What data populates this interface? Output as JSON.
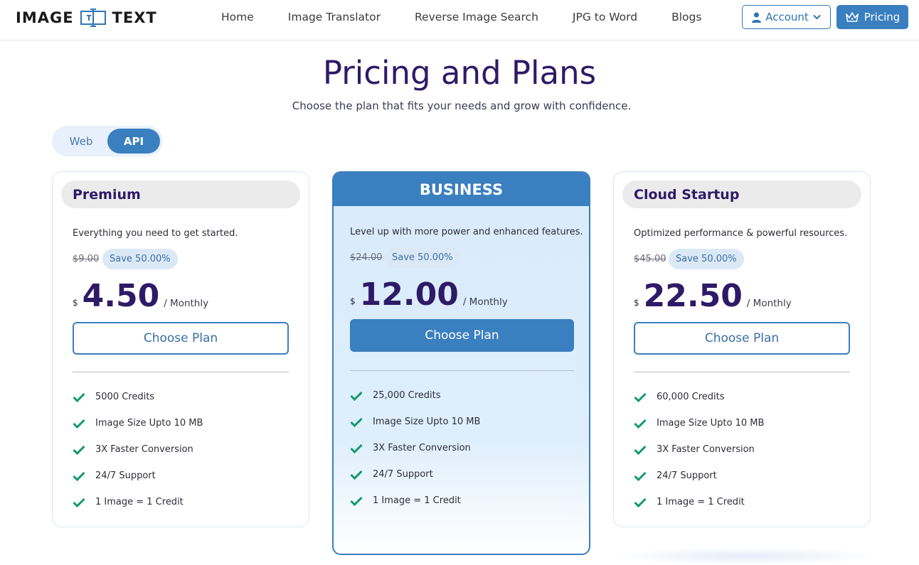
{
  "header": {
    "logo_left": "IMAGE",
    "logo_right": "TEXT",
    "nav": [
      "Home",
      "Image Translator",
      "Reverse Image Search",
      "JPG to Word",
      "Blogs"
    ],
    "account_label": "Account",
    "pricing_label": "Pricing"
  },
  "hero": {
    "title": "Pricing and Plans",
    "subtitle": "Choose the plan that fits your needs and grow with confidence."
  },
  "toggle": {
    "web": "Web",
    "api": "API",
    "selected": "API"
  },
  "colors": {
    "accent": "#3a7fc0",
    "title": "#2e1a66",
    "check": "#129a68"
  },
  "plans": [
    {
      "name": "Premium",
      "description": "Everything you need to get started.",
      "old_price": "$9.00",
      "save": "Save 50.00%",
      "currency": "$",
      "price": "4.50",
      "period": "/ Monthly",
      "cta": "Choose Plan",
      "features": [
        "5000 Credits",
        "Image Size Upto 10 MB",
        "3X Faster Conversion",
        "24/7 Support",
        "1 Image = 1 Credit"
      ]
    },
    {
      "name": "BUSINESS",
      "description": "Level up with more power and enhanced features.",
      "old_price": "$24.00",
      "save": "Save 50.00%",
      "currency": "$",
      "price": "12.00",
      "period": "/ Monthly",
      "cta": "Choose Plan",
      "features": [
        "25,000 Credits",
        "Image Size Upto 10 MB",
        "3X Faster Conversion",
        "24/7 Support",
        "1 Image = 1 Credit"
      ]
    },
    {
      "name": "Cloud Startup",
      "description": "Optimized performance & powerful resources.",
      "old_price": "$45.00",
      "save": "Save 50.00%",
      "currency": "$",
      "price": "22.50",
      "period": "/ Monthly",
      "cta": "Choose Plan",
      "features": [
        "60,000 Credits",
        "Image Size Upto 10 MB",
        "3X Faster Conversion",
        "24/7 Support",
        "1 Image = 1 Credit"
      ]
    }
  ]
}
